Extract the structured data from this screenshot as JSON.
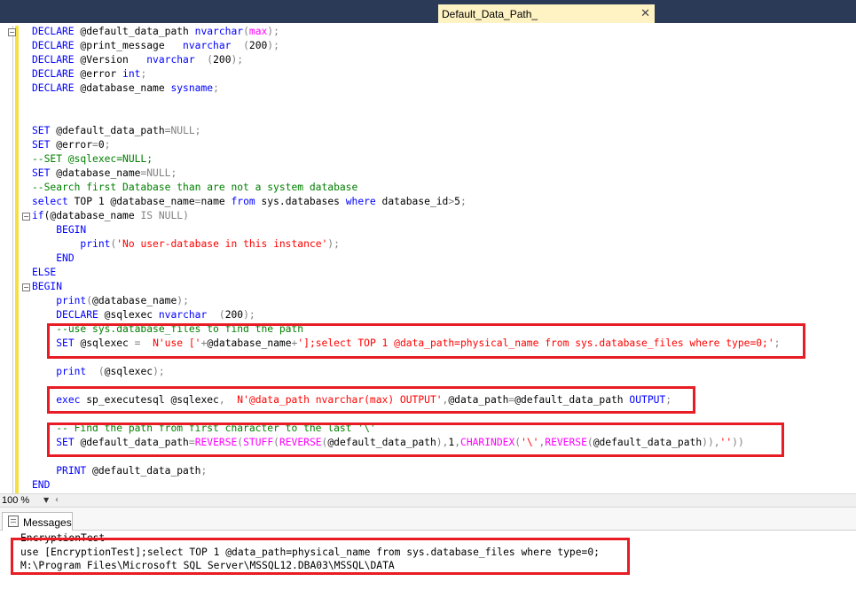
{
  "document_tab": {
    "title": "Default_Data_Path_",
    "close_glyph": "✕"
  },
  "zoom_level": "100 %",
  "results_tab": {
    "label": "Messages"
  },
  "code_lines": [
    [
      [
        "kw",
        "DECLARE"
      ],
      [
        "",
        "@default_data_path "
      ],
      [
        "kw",
        "nvarchar"
      ],
      [
        "gry",
        "("
      ],
      [
        "fn",
        "max"
      ],
      [
        "gry",
        ");"
      ]
    ],
    [
      [
        "kw",
        "DECLARE"
      ],
      [
        "",
        "@print_message   "
      ],
      [
        "kw",
        "nvarchar"
      ],
      [
        "",
        "  "
      ],
      [
        "gry",
        "("
      ],
      [
        "",
        "200"
      ],
      [
        "gry",
        ");"
      ]
    ],
    [
      [
        "kw",
        "DECLARE"
      ],
      [
        "",
        "@Version   "
      ],
      [
        "kw",
        "nvarchar"
      ],
      [
        "",
        "  "
      ],
      [
        "gry",
        "("
      ],
      [
        "",
        "200"
      ],
      [
        "gry",
        ");"
      ]
    ],
    [
      [
        "kw",
        "DECLARE"
      ],
      [
        "",
        "@error "
      ],
      [
        "kw",
        "int"
      ],
      [
        "gry",
        ";"
      ]
    ],
    [
      [
        "kw",
        "DECLARE"
      ],
      [
        "",
        "@database_name "
      ],
      [
        "kw",
        "sysname"
      ],
      [
        "gry",
        ";"
      ]
    ],
    [],
    [],
    [
      [
        "kw",
        "SET"
      ],
      [
        "",
        "@default_data_path"
      ],
      [
        "gry",
        "="
      ],
      [
        "gry",
        "NULL;"
      ]
    ],
    [
      [
        "kw",
        "SET"
      ],
      [
        "",
        "@error"
      ],
      [
        "gry",
        "="
      ],
      [
        "",
        "0"
      ],
      [
        "gry",
        ";"
      ]
    ],
    [
      [
        "cmt",
        "--SET @sqlexec=NULL;"
      ]
    ],
    [
      [
        "kw",
        "SET"
      ],
      [
        "",
        "@database_name"
      ],
      [
        "gry",
        "="
      ],
      [
        "gry",
        "NULL;"
      ]
    ],
    [
      [
        "cmt",
        "--Search first Database than are not a system database"
      ]
    ],
    [
      [
        "kw",
        "select"
      ],
      [
        "",
        "TOP "
      ],
      [
        "",
        "1 @database_name"
      ],
      [
        "gry",
        "="
      ],
      [
        "",
        "name "
      ],
      [
        "kw",
        "from"
      ],
      [
        "",
        "sys.databases "
      ],
      [
        "kw",
        "where"
      ],
      [
        "",
        "database_id"
      ],
      [
        "gry",
        ">"
      ],
      [
        "",
        "5"
      ],
      [
        "gry",
        ";"
      ]
    ],
    [
      [
        "kw",
        "if"
      ],
      [
        "",
        "("
      ],
      [
        "",
        "@database_name "
      ],
      [
        "gry",
        "IS NULL"
      ],
      [
        "gry",
        ")"
      ]
    ],
    [
      [
        "",
        "    "
      ],
      [
        "kw",
        "BEGIN"
      ]
    ],
    [
      [
        "",
        "        "
      ],
      [
        "kw",
        "print"
      ],
      [
        "gry",
        "("
      ],
      [
        "str",
        "'No user-database in this instance'"
      ],
      [
        "gry",
        ");"
      ]
    ],
    [
      [
        "",
        "    "
      ],
      [
        "kw",
        "END"
      ]
    ],
    [
      [
        "kw",
        "ELSE"
      ]
    ],
    [
      [
        "kw",
        "BEGIN"
      ]
    ],
    [
      [
        "",
        "    "
      ],
      [
        "kw",
        "print"
      ],
      [
        "gry",
        "("
      ],
      [
        "",
        "@database_name"
      ],
      [
        "gry",
        ");"
      ]
    ],
    [
      [
        "",
        "    "
      ],
      [
        "kw",
        "DECLARE"
      ],
      [
        "",
        "@sqlexec "
      ],
      [
        "kw",
        "nvarchar"
      ],
      [
        "",
        "  "
      ],
      [
        "gry",
        "("
      ],
      [
        "",
        "200"
      ],
      [
        "gry",
        ");"
      ]
    ],
    [
      [
        "",
        "    "
      ],
      [
        "cmt",
        "--use sys.database_files to find the path"
      ]
    ],
    [
      [
        "",
        "    "
      ],
      [
        "kw",
        "SET"
      ],
      [
        "",
        "@sqlexec "
      ],
      [
        "gry",
        "="
      ],
      [
        "",
        "  "
      ],
      [
        "str",
        "N'use ['"
      ],
      [
        "gry",
        "+"
      ],
      [
        "",
        "@database_name"
      ],
      [
        "gry",
        "+"
      ],
      [
        "str",
        "'];select TOP 1 @data_path=physical_name from sys.database_files where type=0;'"
      ],
      [
        "gry",
        ";"
      ]
    ],
    [],
    [
      [
        "",
        "    "
      ],
      [
        "kw",
        "print"
      ],
      [
        "",
        "  "
      ],
      [
        "gry",
        "("
      ],
      [
        "",
        "@sqlexec"
      ],
      [
        "gry",
        ");"
      ]
    ],
    [],
    [
      [
        "",
        "    "
      ],
      [
        "kw",
        "exec"
      ],
      [
        "",
        "sp_executesql @sqlexec"
      ],
      [
        "gry",
        ","
      ],
      [
        "",
        "  "
      ],
      [
        "str",
        "N'@data_path nvarchar(max) OUTPUT'"
      ],
      [
        "gry",
        ","
      ],
      [
        "",
        "@data_path"
      ],
      [
        "gry",
        "="
      ],
      [
        "",
        "@default_data_path "
      ],
      [
        "kw",
        "OUTPUT"
      ],
      [
        "gry",
        ";"
      ]
    ],
    [],
    [
      [
        "",
        "    "
      ],
      [
        "cmt",
        "-- Find the path from first character to the last '\\'"
      ]
    ],
    [
      [
        "",
        "    "
      ],
      [
        "kw",
        "SET"
      ],
      [
        "",
        "@default_data_path"
      ],
      [
        "gry",
        "="
      ],
      [
        "fn",
        "REVERSE"
      ],
      [
        "gry",
        "("
      ],
      [
        "fn",
        "STUFF"
      ],
      [
        "gry",
        "("
      ],
      [
        "fn",
        "REVERSE"
      ],
      [
        "gry",
        "("
      ],
      [
        "",
        "@default_data_path"
      ],
      [
        "gry",
        "),"
      ],
      [
        "",
        "1"
      ],
      [
        "gry",
        ","
      ],
      [
        "fn",
        "CHARINDEX"
      ],
      [
        "gry",
        "("
      ],
      [
        "str",
        "'\\'"
      ],
      [
        "gry",
        ","
      ],
      [
        "fn",
        "REVERSE"
      ],
      [
        "gry",
        "("
      ],
      [
        "",
        "@default_data_path"
      ],
      [
        "gry",
        ")),"
      ],
      [
        "str",
        "''"
      ],
      [
        "gry",
        "))"
      ]
    ],
    [],
    [
      [
        "",
        "    "
      ],
      [
        "kw",
        "PRINT"
      ],
      [
        "",
        "@default_data_path"
      ],
      [
        "gry",
        ";"
      ]
    ],
    [
      [
        "kw",
        "END"
      ]
    ]
  ],
  "messages": [
    "EncryptionTest",
    "use [EncryptionTest];select TOP 1 @data_path=physical_name from sys.database_files where type=0;",
    "M:\\Program Files\\Microsoft SQL Server\\MSSQL12.DBA03\\MSSQL\\DATA"
  ]
}
